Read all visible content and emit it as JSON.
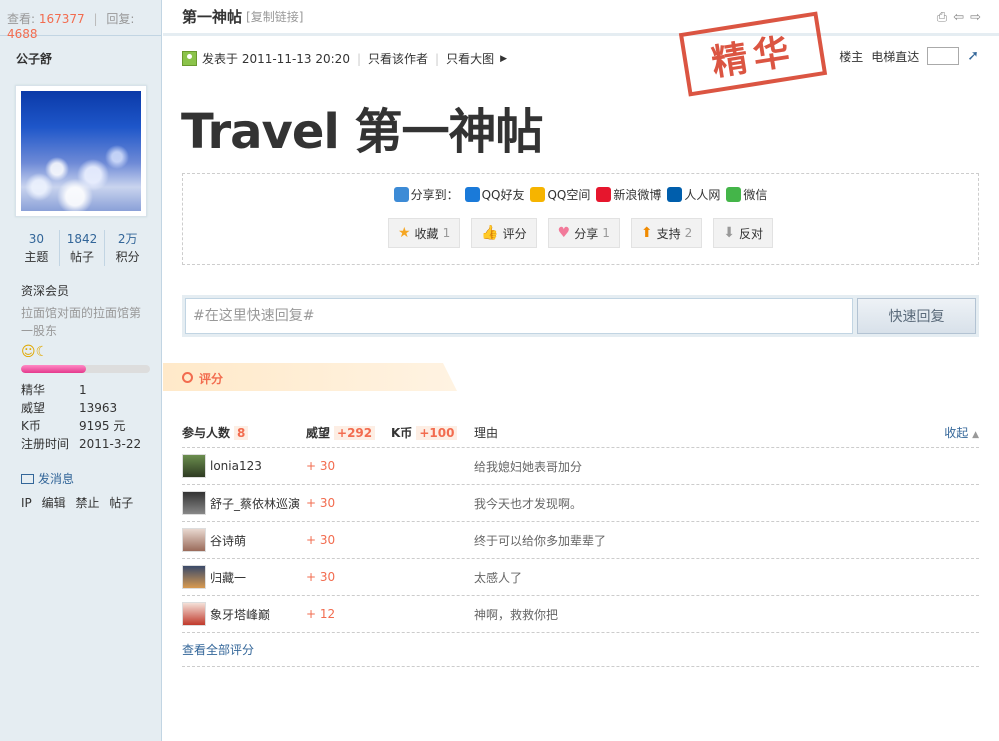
{
  "topbar": {
    "views_label": "查看:",
    "views": "167377",
    "replies_label": "回复:",
    "replies": "4688"
  },
  "author": {
    "name": "公子舒",
    "stats": [
      {
        "value": "30",
        "label": "主题"
      },
      {
        "value": "1842",
        "label": "帖子"
      },
      {
        "value": "2万",
        "label": "积分"
      }
    ],
    "group": "资深会员",
    "custom_title": "拉面馆对面的拉面馆第一股东",
    "level_fraction": 0.5,
    "profile": [
      {
        "key": "精华",
        "value": "1"
      },
      {
        "key": "威望",
        "value": "13963"
      },
      {
        "key": "K币",
        "value": "9195 元"
      },
      {
        "key": "注册时间",
        "value": "2011-3-22"
      }
    ],
    "send_msg": "发消息",
    "admin_links": [
      "IP",
      "编辑",
      "禁止",
      "帖子"
    ]
  },
  "thread": {
    "title": "第一神帖",
    "copy_link": "[复制链接]",
    "stamp": "精华",
    "post_title": "Travel 第一神帖",
    "posted_at": "发表于 2011-11-13 20:20",
    "only_author": "只看该作者",
    "big_images": "只看大图",
    "floor_label": "楼主",
    "elevator": "电梯直达"
  },
  "share": {
    "label": "分享到：",
    "targets": [
      {
        "name": "QQ好友",
        "color": "#1a7ad9"
      },
      {
        "name": "QQ空间",
        "color": "#f6b400"
      },
      {
        "name": "新浪微博",
        "color": "#e6162d"
      },
      {
        "name": "人人网",
        "color": "#005eac"
      },
      {
        "name": "微信",
        "color": "#44b549"
      }
    ]
  },
  "actions": [
    {
      "label": "收藏",
      "count": "1",
      "icon": "★"
    },
    {
      "label": "评分",
      "count": "",
      "icon": "👍"
    },
    {
      "label": "分享",
      "count": "1",
      "icon": "♥"
    },
    {
      "label": "支持",
      "count": "2",
      "icon": "⬆"
    },
    {
      "label": "反对",
      "count": "",
      "icon": "⬇"
    }
  ],
  "quick_reply": {
    "placeholder": "#在这里快速回复#",
    "button": "快速回复"
  },
  "rating": {
    "tab": "评分",
    "participants_label": "参与人数",
    "participants": "8",
    "weiwang_label": "威望",
    "weiwang_total": "+292",
    "kb_label": "K币",
    "kb_total": "+100",
    "reason_label": "理由",
    "collapse": "收起",
    "rows": [
      {
        "user": "lonia123",
        "score": "+ 30",
        "reason": "给我媳妇她表哥加分"
      },
      {
        "user": "舒子_蔡依林巡演",
        "score": "+ 30",
        "reason": "我今天也才发现啊。"
      },
      {
        "user": "谷诗萌",
        "score": "+ 30",
        "reason": "终于可以给你多加辈辈了"
      },
      {
        "user": "归藏一",
        "score": "+ 30",
        "reason": "太感人了"
      },
      {
        "user": "象牙塔峰巅",
        "score": "+ 12",
        "reason": "神啊，救救你把"
      }
    ],
    "view_all": "查看全部评分"
  }
}
